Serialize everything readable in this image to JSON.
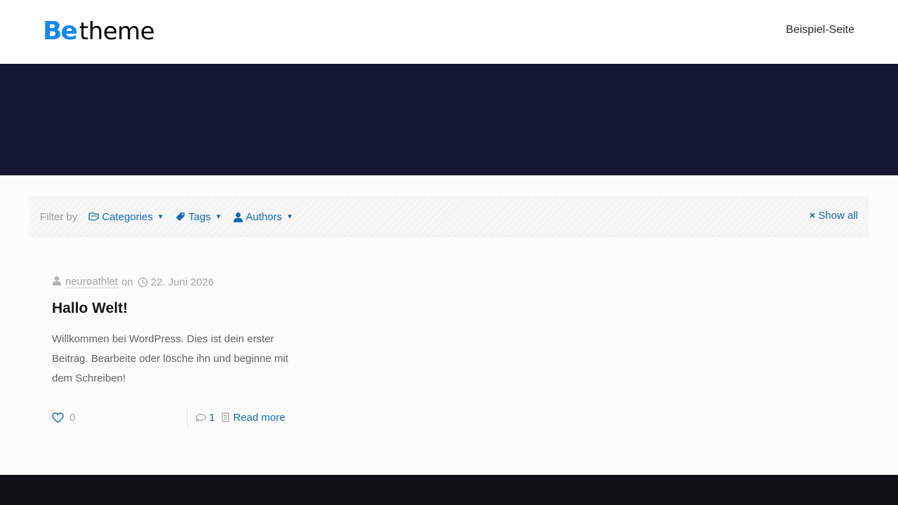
{
  "header": {
    "logo": {
      "part1": "Be",
      "part2": "theme"
    },
    "nav": [
      {
        "label": "Beispiel-Seite"
      }
    ]
  },
  "filter": {
    "label": "Filter by",
    "items": [
      {
        "label": "Categories",
        "icon": "folder-icon"
      },
      {
        "label": "Tags",
        "icon": "tag-icon"
      },
      {
        "label": "Authors",
        "icon": "user-icon"
      }
    ],
    "show_all": "Show all"
  },
  "post": {
    "author": "neuroathlet",
    "on": "on",
    "date": "22. Juni 2026",
    "title": "Hallo Welt!",
    "excerpt": "Willkommen bei WordPress. Dies ist dein erster Beitrag. Bearbeite oder lösche ihn und beginne mit dem Schreiben!",
    "likes": "0",
    "comments": "1",
    "read_more": "Read more"
  },
  "colors": {
    "brand_blue": "#1a86f0",
    "link": "#0e6bb5",
    "hero_bg": "#131733",
    "footer_bg": "#0f0f14"
  }
}
